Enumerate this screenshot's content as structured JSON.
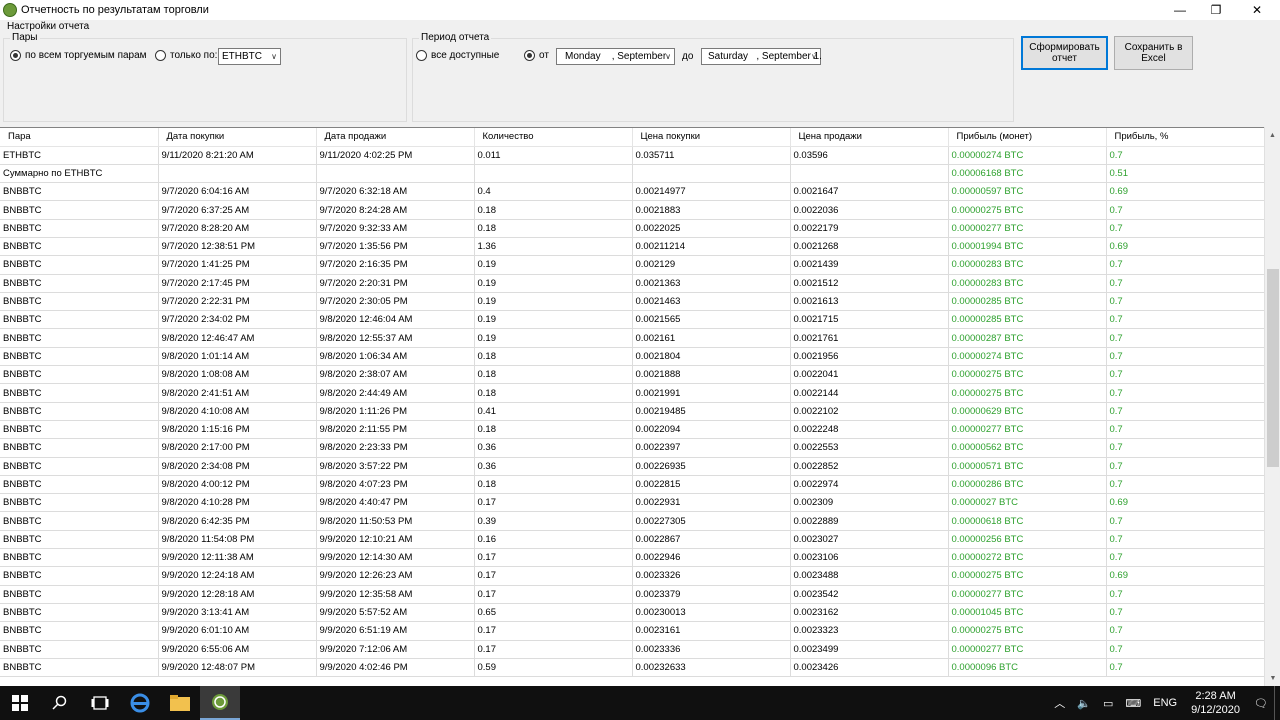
{
  "window": {
    "title": "Отчетность по результатам торговли",
    "minimize": "—",
    "maximize": "❐",
    "close": "✕"
  },
  "settings": {
    "label": "Настройки отчета",
    "pairs": {
      "title": "Пары",
      "all_label": "по всем торгуемым парам",
      "only_label": "только по:",
      "pair_value": "ETHBTC"
    },
    "period": {
      "title": "Период отчета",
      "all_label": "все доступные",
      "from_label": "от",
      "from_value": "Monday    , September",
      "to_label": "до",
      "to_value": "Saturday   , September 1."
    },
    "generate_button": "Сформировать\nотчет",
    "excel_button": "Сохранить в\nExcel"
  },
  "table": {
    "columns": [
      "Пара",
      "Дата покупки",
      "Дата продажи",
      "Количество",
      "Цена покупки",
      "Цена продажи",
      "Прибыль (монет)",
      "Прибыль, %"
    ],
    "rows": [
      [
        "ETHBTC",
        "9/11/2020 8:21:20 AM",
        "9/11/2020 4:02:25 PM",
        "0.011",
        "0.035711",
        "0.03596",
        "0.00000274 BTC",
        "0.7"
      ],
      [
        "Суммарно по ETHBTC",
        "",
        "",
        "",
        "",
        "",
        "0.00006168 BTC",
        "0.51"
      ],
      [
        "BNBBTC",
        "9/7/2020 6:04:16 AM",
        "9/7/2020 6:32:18 AM",
        "0.4",
        "0.00214977",
        "0.0021647",
        "0.00000597 BTC",
        "0.69"
      ],
      [
        "BNBBTC",
        "9/7/2020 6:37:25 AM",
        "9/7/2020 8:24:28 AM",
        "0.18",
        "0.0021883",
        "0.0022036",
        "0.00000275 BTC",
        "0.7"
      ],
      [
        "BNBBTC",
        "9/7/2020 8:28:20 AM",
        "9/7/2020 9:32:33 AM",
        "0.18",
        "0.0022025",
        "0.0022179",
        "0.00000277 BTC",
        "0.7"
      ],
      [
        "BNBBTC",
        "9/7/2020 12:38:51 PM",
        "9/7/2020 1:35:56 PM",
        "1.36",
        "0.00211214",
        "0.0021268",
        "0.00001994 BTC",
        "0.69"
      ],
      [
        "BNBBTC",
        "9/7/2020 1:41:25 PM",
        "9/7/2020 2:16:35 PM",
        "0.19",
        "0.002129",
        "0.0021439",
        "0.00000283 BTC",
        "0.7"
      ],
      [
        "BNBBTC",
        "9/7/2020 2:17:45 PM",
        "9/7/2020 2:20:31 PM",
        "0.19",
        "0.0021363",
        "0.0021512",
        "0.00000283 BTC",
        "0.7"
      ],
      [
        "BNBBTC",
        "9/7/2020 2:22:31 PM",
        "9/7/2020 2:30:05 PM",
        "0.19",
        "0.0021463",
        "0.0021613",
        "0.00000285 BTC",
        "0.7"
      ],
      [
        "BNBBTC",
        "9/7/2020 2:34:02 PM",
        "9/8/2020 12:46:04 AM",
        "0.19",
        "0.0021565",
        "0.0021715",
        "0.00000285 BTC",
        "0.7"
      ],
      [
        "BNBBTC",
        "9/8/2020 12:46:47 AM",
        "9/8/2020 12:55:37 AM",
        "0.19",
        "0.002161",
        "0.0021761",
        "0.00000287 BTC",
        "0.7"
      ],
      [
        "BNBBTC",
        "9/8/2020 1:01:14 AM",
        "9/8/2020 1:06:34 AM",
        "0.18",
        "0.0021804",
        "0.0021956",
        "0.00000274 BTC",
        "0.7"
      ],
      [
        "BNBBTC",
        "9/8/2020 1:08:08 AM",
        "9/8/2020 2:38:07 AM",
        "0.18",
        "0.0021888",
        "0.0022041",
        "0.00000275 BTC",
        "0.7"
      ],
      [
        "BNBBTC",
        "9/8/2020 2:41:51 AM",
        "9/8/2020 2:44:49 AM",
        "0.18",
        "0.0021991",
        "0.0022144",
        "0.00000275 BTC",
        "0.7"
      ],
      [
        "BNBBTC",
        "9/8/2020 4:10:08 AM",
        "9/8/2020 1:11:26 PM",
        "0.41",
        "0.00219485",
        "0.0022102",
        "0.00000629 BTC",
        "0.7"
      ],
      [
        "BNBBTC",
        "9/8/2020 1:15:16 PM",
        "9/8/2020 2:11:55 PM",
        "0.18",
        "0.0022094",
        "0.0022248",
        "0.00000277 BTC",
        "0.7"
      ],
      [
        "BNBBTC",
        "9/8/2020 2:17:00 PM",
        "9/8/2020 2:23:33 PM",
        "0.36",
        "0.0022397",
        "0.0022553",
        "0.00000562 BTC",
        "0.7"
      ],
      [
        "BNBBTC",
        "9/8/2020 2:34:08 PM",
        "9/8/2020 3:57:22 PM",
        "0.36",
        "0.00226935",
        "0.0022852",
        "0.00000571 BTC",
        "0.7"
      ],
      [
        "BNBBTC",
        "9/8/2020 4:00:12 PM",
        "9/8/2020 4:07:23 PM",
        "0.18",
        "0.0022815",
        "0.0022974",
        "0.00000286 BTC",
        "0.7"
      ],
      [
        "BNBBTC",
        "9/8/2020 4:10:28 PM",
        "9/8/2020 4:40:47 PM",
        "0.17",
        "0.0022931",
        "0.002309",
        "0.0000027 BTC",
        "0.69"
      ],
      [
        "BNBBTC",
        "9/8/2020 6:42:35 PM",
        "9/8/2020 11:50:53 PM",
        "0.39",
        "0.00227305",
        "0.0022889",
        "0.00000618 BTC",
        "0.7"
      ],
      [
        "BNBBTC",
        "9/8/2020 11:54:08 PM",
        "9/9/2020 12:10:21 AM",
        "0.16",
        "0.0022867",
        "0.0023027",
        "0.00000256 BTC",
        "0.7"
      ],
      [
        "BNBBTC",
        "9/9/2020 12:11:38 AM",
        "9/9/2020 12:14:30 AM",
        "0.17",
        "0.0022946",
        "0.0023106",
        "0.00000272 BTC",
        "0.7"
      ],
      [
        "BNBBTC",
        "9/9/2020 12:24:18 AM",
        "9/9/2020 12:26:23 AM",
        "0.17",
        "0.0023326",
        "0.0023488",
        "0.00000275 BTC",
        "0.69"
      ],
      [
        "BNBBTC",
        "9/9/2020 12:28:18 AM",
        "9/9/2020 12:35:58 AM",
        "0.17",
        "0.0023379",
        "0.0023542",
        "0.00000277 BTC",
        "0.7"
      ],
      [
        "BNBBTC",
        "9/9/2020 3:13:41 AM",
        "9/9/2020 5:57:52 AM",
        "0.65",
        "0.00230013",
        "0.0023162",
        "0.00001045 BTC",
        "0.7"
      ],
      [
        "BNBBTC",
        "9/9/2020 6:01:10 AM",
        "9/9/2020 6:51:19 AM",
        "0.17",
        "0.0023161",
        "0.0023323",
        "0.00000275 BTC",
        "0.7"
      ],
      [
        "BNBBTC",
        "9/9/2020 6:55:06 AM",
        "9/9/2020 7:12:06 AM",
        "0.17",
        "0.0023336",
        "0.0023499",
        "0.00000277 BTC",
        "0.7"
      ],
      [
        "BNBBTC",
        "9/9/2020 12:48:07 PM",
        "9/9/2020 4:02:46 PM",
        "0.59",
        "0.00232633",
        "0.0023426",
        "0.0000096 BTC",
        "0.7"
      ]
    ]
  },
  "taskbar": {
    "tray": {
      "lang": "ENG",
      "time": "2:28 AM",
      "date": "9/12/2020"
    }
  }
}
